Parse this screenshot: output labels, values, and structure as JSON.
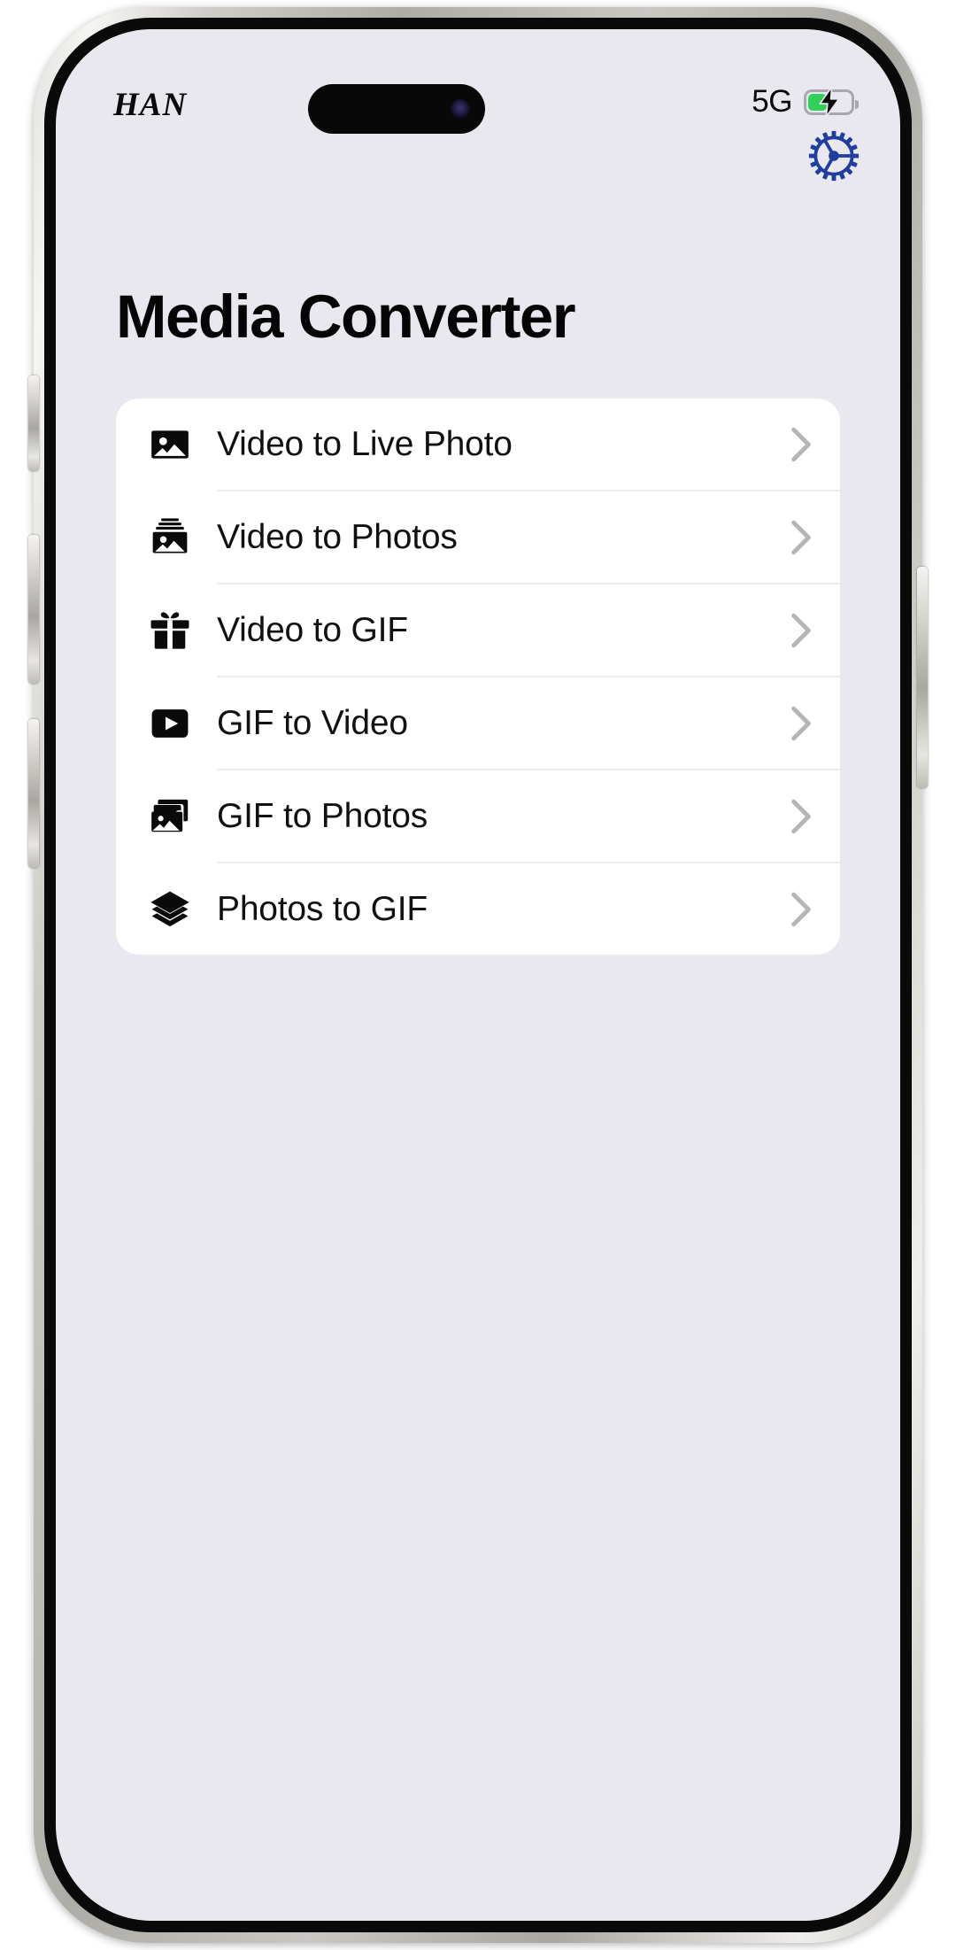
{
  "status_bar": {
    "carrier": "HAN",
    "network": "5G",
    "battery_icon": "battery-charging-icon",
    "battery_level_percent": 45,
    "charging": true,
    "dynamic_island": "dynamic-island",
    "front_camera": "front-camera-dot"
  },
  "colors": {
    "screen_background": "#e9e8ee",
    "card_background": "#ffffff",
    "gear_accent": "#1f3f9e",
    "battery_green": "#2fd158",
    "divider": "#ececee",
    "chevron": "#b4b4b9",
    "title_text": "#050505"
  },
  "header": {
    "settings_icon": "gear-icon",
    "title": "Media Converter"
  },
  "menu": {
    "items": [
      {
        "label": "Video to Live Photo",
        "icon": "photo-portrait-icon",
        "chevron": "chevron-right-icon"
      },
      {
        "label": "Video to Photos",
        "icon": "photo-stack-icon",
        "chevron": "chevron-right-icon"
      },
      {
        "label": "Video to GIF",
        "icon": "gift-box-icon",
        "chevron": "chevron-right-icon"
      },
      {
        "label": "GIF to Video",
        "icon": "play-square-icon",
        "chevron": "chevron-right-icon"
      },
      {
        "label": "GIF to Photos",
        "icon": "photo-multiple-icon",
        "chevron": "chevron-right-icon"
      },
      {
        "label": "Photos to GIF",
        "icon": "layers-icon",
        "chevron": "chevron-right-icon"
      }
    ]
  }
}
